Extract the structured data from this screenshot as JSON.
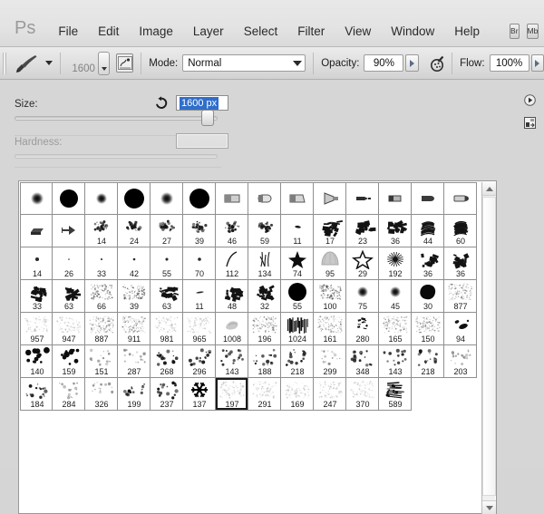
{
  "app": {
    "logo": "Ps",
    "menus": [
      "File",
      "Edit",
      "Image",
      "Layer",
      "Select",
      "Filter",
      "View",
      "Window",
      "Help"
    ],
    "app_buttons": [
      {
        "name": "bridge-button",
        "label": "Br"
      },
      {
        "name": "mini-bridge-button",
        "label": "Mb"
      },
      {
        "name": "view-extras-button",
        "label": ""
      }
    ]
  },
  "options_bar": {
    "tool_icon": "brush-icon",
    "tool_preset_arrow": "chevron-down-icon",
    "brush_size_preview": "1600",
    "brush_dropdown_icon": "chevron-down-icon",
    "tablet_pressure_icon": "tablet-pressure-icon",
    "mode_label": "Mode:",
    "mode_value": "Normal",
    "opacity_label": "Opacity:",
    "opacity_value": "90%",
    "airbrush_icon": "airbrush-icon",
    "flow_label": "Flow:",
    "flow_value": "100%"
  },
  "picker": {
    "size_label": "Size:",
    "size_reset_icon": "reset-icon",
    "size_value": "1600 px",
    "size_slider_percent": 93,
    "hardness_label": "Hardness:",
    "hardness_value": "",
    "hardness_disabled": true,
    "panel_menu_icon": "panel-menu-icon",
    "preset_manager_icon": "preset-manager-icon",
    "scrollbar": {
      "up_icon": "scroll-up-icon",
      "down_icon": "scroll-down-icon"
    },
    "selected_brush": "197",
    "rows": [
      [
        {
          "n": "",
          "g": "soft1"
        },
        {
          "n": "",
          "g": "hard1"
        },
        {
          "n": "",
          "g": "soft2"
        },
        {
          "n": "",
          "g": "hard2"
        },
        {
          "n": "",
          "g": "soft3"
        },
        {
          "n": "",
          "g": "hard3"
        },
        {
          "n": "",
          "g": "flat1"
        },
        {
          "n": "",
          "g": "flat2"
        },
        {
          "n": "",
          "g": "flat3"
        },
        {
          "n": "",
          "g": "flat4"
        },
        {
          "n": "",
          "g": "flat5"
        },
        {
          "n": "",
          "g": "flat6"
        },
        {
          "n": "",
          "g": "flat7"
        },
        {
          "n": "",
          "g": "flat8"
        }
      ],
      [
        {
          "n": "",
          "g": "tool1"
        },
        {
          "n": "",
          "g": "tool2"
        },
        {
          "n": "14",
          "g": "spat"
        },
        {
          "n": "24",
          "g": "spat"
        },
        {
          "n": "27",
          "g": "spat"
        },
        {
          "n": "39",
          "g": "spat"
        },
        {
          "n": "46",
          "g": "spat"
        },
        {
          "n": "59",
          "g": "spat"
        },
        {
          "n": "11",
          "g": "dab"
        },
        {
          "n": "17",
          "g": "chalk"
        },
        {
          "n": "23",
          "g": "chalk"
        },
        {
          "n": "36",
          "g": "chalk"
        },
        {
          "n": "44",
          "g": "strokes"
        },
        {
          "n": "60",
          "g": "strokes"
        }
      ],
      [
        {
          "n": "14",
          "g": "dot"
        },
        {
          "n": "26",
          "g": "dot"
        },
        {
          "n": "33",
          "g": "dot"
        },
        {
          "n": "42",
          "g": "dot"
        },
        {
          "n": "55",
          "g": "dot"
        },
        {
          "n": "70",
          "g": "dot"
        },
        {
          "n": "112",
          "g": "curve"
        },
        {
          "n": "134",
          "g": "grass"
        },
        {
          "n": "74",
          "g": "star-solid"
        },
        {
          "n": "95",
          "g": "shell"
        },
        {
          "n": "29",
          "g": "star-outline"
        },
        {
          "n": "192",
          "g": "burst"
        },
        {
          "n": "36",
          "g": "chalk"
        },
        {
          "n": "36",
          "g": "chalk"
        }
      ],
      [
        {
          "n": "33",
          "g": "chalk"
        },
        {
          "n": "63",
          "g": "chalk"
        },
        {
          "n": "66",
          "g": "grain"
        },
        {
          "n": "39",
          "g": "grain"
        },
        {
          "n": "63",
          "g": "chalk"
        },
        {
          "n": "11",
          "g": "sliver"
        },
        {
          "n": "48",
          "g": "chalk"
        },
        {
          "n": "32",
          "g": "chalk"
        },
        {
          "n": "55",
          "g": "hard1"
        },
        {
          "n": "100",
          "g": "grain"
        },
        {
          "n": "75",
          "g": "soft2"
        },
        {
          "n": "45",
          "g": "soft2"
        },
        {
          "n": "30",
          "g": "blob"
        },
        {
          "n": "877",
          "g": "spray"
        }
      ],
      [
        {
          "n": "957",
          "g": "faint"
        },
        {
          "n": "947",
          "g": "faint"
        },
        {
          "n": "887",
          "g": "spray"
        },
        {
          "n": "911",
          "g": "spray"
        },
        {
          "n": "981",
          "g": "faint"
        },
        {
          "n": "965",
          "g": "faint"
        },
        {
          "n": "1008",
          "g": "smudge"
        },
        {
          "n": "196",
          "g": "spray"
        },
        {
          "n": "1024",
          "g": "texture"
        },
        {
          "n": "161",
          "g": "spray"
        },
        {
          "n": "280",
          "g": "dashes"
        },
        {
          "n": "165",
          "g": "spray"
        },
        {
          "n": "150",
          "g": "spray"
        },
        {
          "n": "94",
          "g": "blobs"
        }
      ],
      [
        {
          "n": "140",
          "g": "dots-b"
        },
        {
          "n": "159",
          "g": "dots-b"
        },
        {
          "n": "151",
          "g": "dots-l"
        },
        {
          "n": "287",
          "g": "dots-l"
        },
        {
          "n": "268",
          "g": "dots-m"
        },
        {
          "n": "296",
          "g": "dots-m"
        },
        {
          "n": "143",
          "g": "dots-m"
        },
        {
          "n": "188",
          "g": "dots-m"
        },
        {
          "n": "218",
          "g": "dots-m"
        },
        {
          "n": "299",
          "g": "dots-l"
        },
        {
          "n": "348",
          "g": "dots-m"
        },
        {
          "n": "143",
          "g": "dots-m"
        },
        {
          "n": "218",
          "g": "dots-m"
        },
        {
          "n": "203",
          "g": "dots-l"
        }
      ],
      [
        {
          "n": "184",
          "g": "dots-m"
        },
        {
          "n": "284",
          "g": "dots-l"
        },
        {
          "n": "326",
          "g": "dots-l"
        },
        {
          "n": "199",
          "g": "dots-m"
        },
        {
          "n": "237",
          "g": "dots-m"
        },
        {
          "n": "137",
          "g": "snowflake"
        },
        {
          "n": "197",
          "g": "faint"
        },
        {
          "n": "291",
          "g": "faint"
        },
        {
          "n": "169",
          "g": "faint"
        },
        {
          "n": "247",
          "g": "faint"
        },
        {
          "n": "370",
          "g": "faint"
        },
        {
          "n": "589",
          "g": "scratch"
        }
      ]
    ]
  }
}
